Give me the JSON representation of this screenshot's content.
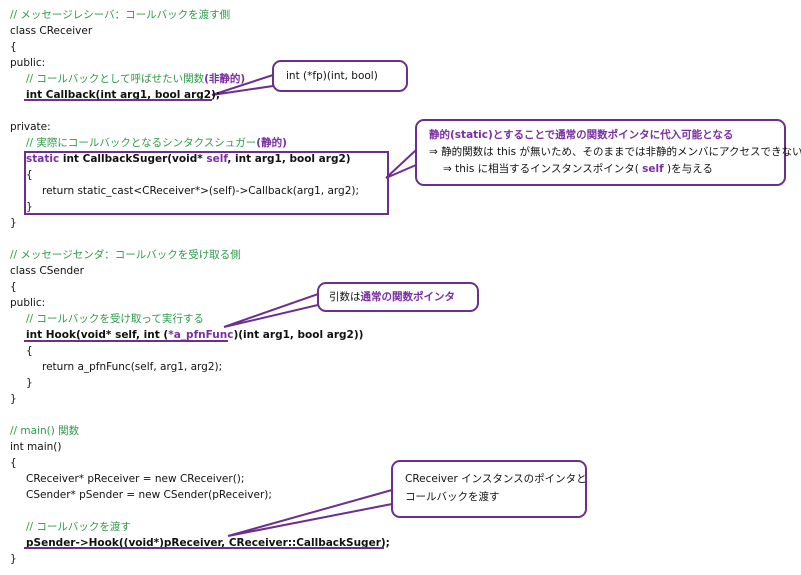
{
  "code": {
    "l01": "// メッセージレシーバ：コールバックを渡す側",
    "l02": "class CReceiver",
    "l03": "{",
    "l04": "public:",
    "l05": "// コールバックとして呼ばせたい関数",
    "l05b": "(非静的)",
    "l06": "int Callback(int arg1, bool arg2);",
    "l08": "private:",
    "l09": "// 実際にコールバックとなるシンタクスシュガー",
    "l09b": "(静的)",
    "l10a": "static",
    "l10b": " int CallbackSuger(void* ",
    "l10c": "self",
    "l10d": ", int arg1, bool arg2)",
    "l11": "{",
    "l12": "return static_cast<CReceiver*>(self)->Callback(arg1, arg2);",
    "l13": "}",
    "l14": "}",
    "l16": "// メッセージセンダ：コールバックを受け取る側",
    "l17": "class CSender",
    "l18": "{",
    "l19": "public:",
    "l20": "// コールバックを受け取って実行する",
    "l21a": "int Hook(void* self, int (",
    "l21b": "*a_pfnFunc",
    "l21c": ")(int arg1, bool arg2))",
    "l22": "{",
    "l23": "return a_pfnFunc(self, arg1, arg2);",
    "l24": "}",
    "l25": "}",
    "l27": "// main() 関数",
    "l28": "int main()",
    "l29": "{",
    "l30": "CReceiver* pReceiver = new CReceiver();",
    "l31": "CSender* pSender = new CSender(pReceiver);",
    "l33": "// コールバックを渡す",
    "l34": "pSender->Hook((void*)pReceiver, CReceiver::CallbackSuger);",
    "l35": "}"
  },
  "callouts": {
    "c1": "int (*fp)(int, bool)",
    "c2_title": "静的(static)とすることで通常の関数ポインタに代入可能となる",
    "c2_line1": "⇒ 静的関数は this が無いため、そのままでは非静的メンバにアクセスできない",
    "c2_line2a": "⇒ this に相当するインスタンスポインタ( ",
    "c2_line2b": "self",
    "c2_line2c": " )を与える",
    "c3a": "引数は",
    "c3b": "通常の関数ポインタ",
    "c4_line1": "CReceiver インスタンスのポインタと",
    "c4_line2": "コールバックを渡す"
  },
  "colors": {
    "accent": "#6a2f8f",
    "comment": "#2e9a4a",
    "keyword": "#7a2fa3"
  }
}
